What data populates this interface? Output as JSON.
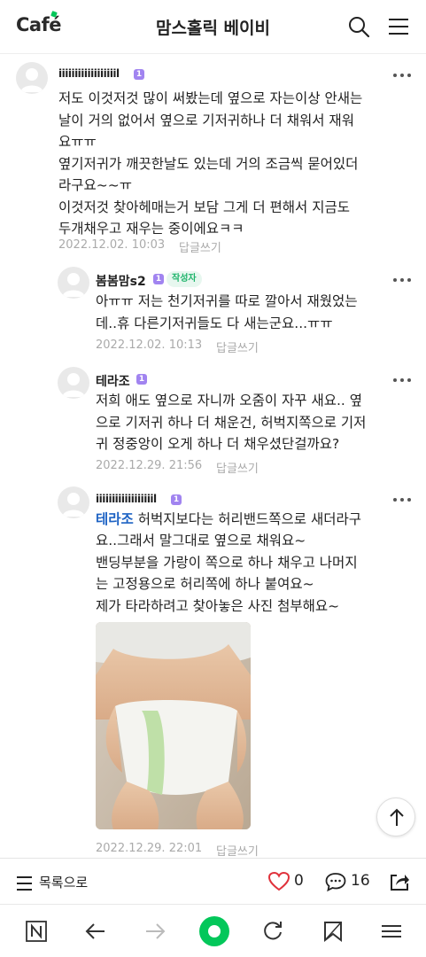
{
  "header": {
    "logo": "Café",
    "title": "맘스홀릭 베이비",
    "search_icon": "search-icon",
    "menu_icon": "hamburger-menu-icon"
  },
  "comments": [
    {
      "nickname": "iiiiiiiiiiiiiiiiiil",
      "level": "1",
      "text": "저도 이것저것 많이 써봤는데 옆으로 자는이상 안새는\n날이 거의 없어서 옆으로 기저귀하나 더 채워서 재워\n요ㅠㅠ\n옆기저귀가 깨끗한날도 있는데 거의 조금씩 묻어있더\n라구요~~ㅠ\n이것저것 찾아헤매는거 보담 그게 더 편해서 지금도\n두개채우고 재우는 중이에요ㅋㅋ",
      "date": "2022.12.02. 10:03",
      "reply": "답글쓰기"
    },
    {
      "nickname": "봄봄맘s2",
      "level": "1",
      "badge": "작성자",
      "text": "아ㅠㅠ 저는 천기저귀를 따로 깔아서 재웠었는\n데..휴 다른기저귀들도 다 새는군요...ㅠㅠ",
      "date": "2022.12.02. 10:13",
      "reply": "답글쓰기"
    },
    {
      "nickname": "테라조",
      "level": "1",
      "text": "저희 애도 옆으로 자니까 오줌이 자꾸 새요.. 옆\n으로 기저귀 하나 더 채운건, 허벅지쪽으로 기저\n귀 정중앙이 오게 하나 더 채우셨단걸까요?",
      "date": "2022.12.29. 21:56",
      "reply": "답글쓰기"
    },
    {
      "nickname": "iiiiiiiiiiiiiiiiiil",
      "level": "1",
      "mention": "테라조",
      "text_first": " 허벅지보다는 허리밴드쪽으로 새더라구",
      "text": "요..그래서 말그대로 옆으로 채워요~\n밴딩부분을 가랑이 쪽으로 하나 채우고 나머지\n는 고정용으로 허리쪽에 하나 붙여요~\n제가 타라하려고 찾아놓은 사진 첨부해요~",
      "date": "2022.12.29. 22:01",
      "reply": "답글쓰기"
    }
  ],
  "bottom_bar": {
    "list_label": "목록으로",
    "like_count": "0",
    "comment_count": "16"
  },
  "browser_nav": [
    "naver-n-icon",
    "back-arrow-icon",
    "forward-arrow-icon",
    "home-green-circle-icon",
    "refresh-icon",
    "bookmark-icon",
    "menu-icon"
  ],
  "colors": {
    "accent": "#03c75a",
    "mention": "#1e63c4",
    "level_badge": "#a184f0",
    "like_heart": "#e0323c"
  }
}
